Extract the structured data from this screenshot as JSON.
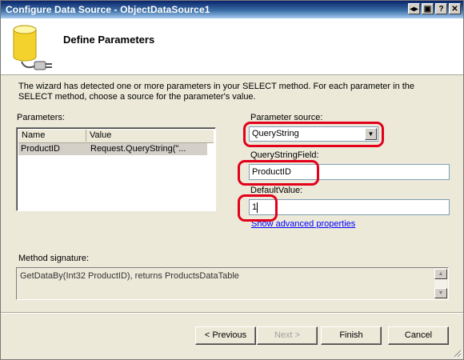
{
  "window": {
    "title": "Configure Data Source - ObjectDataSource1"
  },
  "titlebar_buttons": [
    {
      "glyph": "◂▸"
    },
    {
      "glyph": "▣"
    },
    {
      "glyph": "?"
    },
    {
      "glyph": "✕"
    }
  ],
  "header": {
    "title": "Define Parameters",
    "icon": "database-connector-icon"
  },
  "description": "The wizard has detected one or more parameters in your SELECT method. For each parameter in the SELECT method, choose a source for the parameter's value.",
  "parameters": {
    "label": "Parameters:",
    "columns": [
      "Name",
      "Value"
    ],
    "rows": [
      {
        "name": "ProductID",
        "value": "Request.QueryString(\"..."
      }
    ]
  },
  "parameter_source": {
    "label": "Parameter source:",
    "value": "QueryString"
  },
  "querystring_field": {
    "label": "QueryStringField:",
    "value": "ProductID"
  },
  "default_value": {
    "label": "DefaultValue:",
    "value": "1"
  },
  "advanced_link": "Show advanced properties",
  "method_signature": {
    "label": "Method signature:",
    "value": "GetDataBy(Int32 ProductID), returns ProductsDataTable"
  },
  "buttons": {
    "previous": "< Previous",
    "next": "Next >",
    "finish": "Finish",
    "cancel": "Cancel"
  },
  "colors": {
    "highlight": "#e3001b",
    "link": "#0000ff",
    "title_bar": "#0a246a"
  }
}
